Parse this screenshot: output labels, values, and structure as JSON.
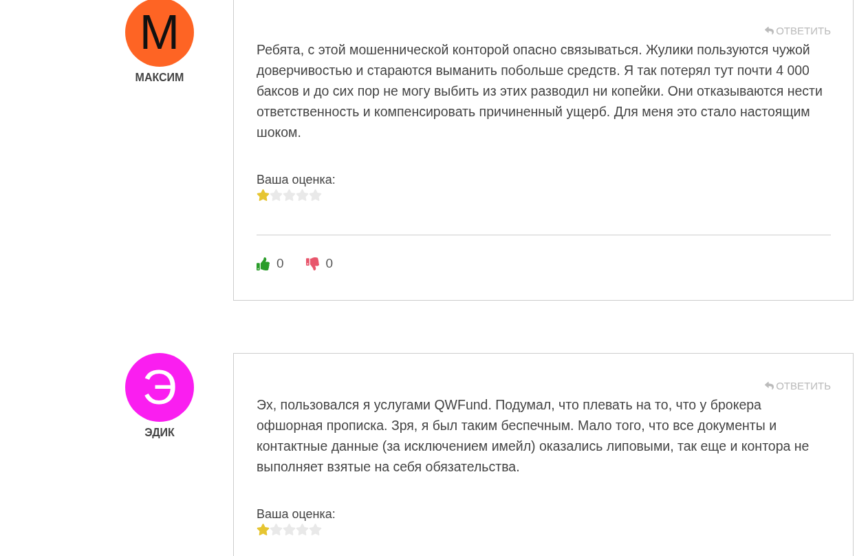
{
  "comments": [
    {
      "author": "МАКСИМ",
      "initial": "М",
      "color": "#fe6424",
      "reply": "ОТВЕТИТЬ",
      "text": "Ребята, с этой мошеннической конторой опасно связываться. Жулики пользуются чужой доверчивостью и стараются выманить побольше средств. Я так потерял тут почти 4 000 баксов и до сих пор не могу выбить из этих разводил ни копейки. Они отказываются нести ответственность и компенсировать причиненный ущерб. Для меня это стало настоящим шоком.",
      "rating_label": "Ваша оценка:",
      "stars": 1,
      "likes": "0",
      "dislikes": "0"
    },
    {
      "author": "ЭДИК",
      "initial": "Э",
      "color": "#fa1ef0",
      "reply": "ОТВЕТИТЬ",
      "text": "Эх, пользовался я услугами QWFund. Подумал, что плевать на то, что у брокера офшорная прописка. Зря, я был таким беспечным. Мало того, что все документы и контактные данные (за исключением имейл) оказались липовыми, так еще и контора не выполняет взятые на себя обязательства.",
      "rating_label": "Ваша оценка:",
      "stars": 1
    }
  ]
}
